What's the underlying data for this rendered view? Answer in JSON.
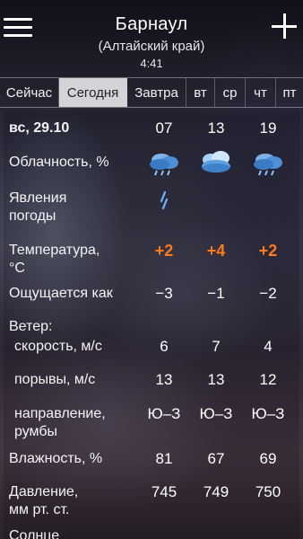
{
  "header": {
    "city": "Барнаул",
    "region": "(Алтайский край)",
    "time": "4:41"
  },
  "tabs": [
    "Сейчас",
    "Сегодня",
    "Завтра",
    "вт",
    "ср",
    "чт",
    "пт"
  ],
  "active_tab": "Сегодня",
  "table": {
    "date": "вс, 29.10",
    "hours": [
      "07",
      "13",
      "19"
    ],
    "cloudiness_label": "Облачность, %",
    "cloud_icons": [
      "cloudy-rain-icon",
      "overcast-icon",
      "cloudy-rain-icon"
    ],
    "phenomena_label": "Явления погоды",
    "phenomena_label_l1": "Явления",
    "phenomena_label_l2": "погоды",
    "phenomena_icons": [
      "light-rain-icon",
      "",
      ""
    ],
    "temperature_label_l1": "Температура,",
    "temperature_label_l2": "°C",
    "temperature": [
      "+2",
      "+4",
      "+2"
    ],
    "feels_label": "Ощущается как",
    "feels": [
      "−3",
      "−1",
      "−2"
    ],
    "wind_label": "Ветер:",
    "wind_speed_label": "скорость, м/с",
    "wind_speed": [
      "6",
      "7",
      "4"
    ],
    "gusts_label": "порывы, м/с",
    "gusts": [
      "13",
      "13",
      "12"
    ],
    "direction_label_l1": "направление,",
    "direction_label_l2": "румбы",
    "direction": [
      "Ю–З",
      "Ю–З",
      "Ю–З"
    ],
    "humidity_label": "Влажность, %",
    "humidity": [
      "81",
      "67",
      "69"
    ],
    "pressure_label_l1": "Давление,",
    "pressure_label_l2": "мм рт. ст.",
    "pressure": [
      "745",
      "749",
      "750"
    ],
    "sun_label": "Солнце"
  },
  "colors": {
    "accent_temperature": "#ff7a1a",
    "active_tab_bg": "#d4d4d8"
  }
}
